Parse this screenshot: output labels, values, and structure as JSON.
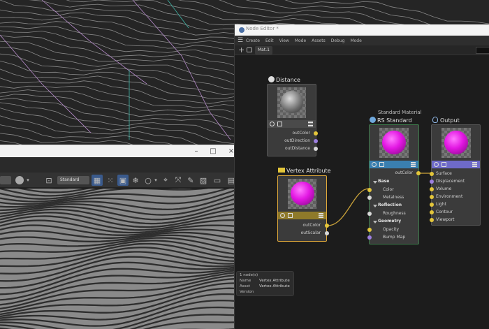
{
  "window": {
    "title": "Node Editor *",
    "menu": [
      "Create",
      "Edit",
      "View",
      "Mode",
      "Assets",
      "Debug",
      "Mode"
    ],
    "tab": "Mat.1"
  },
  "toolbar": {
    "dropdown_label": "Standard"
  },
  "nodes": {
    "distance": {
      "title": "Distance",
      "outputs": [
        "outColor",
        "outDirection",
        "outDistance"
      ]
    },
    "vertex_attribute": {
      "title": "Vertex Attribute",
      "outputs": [
        "outColor",
        "outScalar"
      ]
    },
    "rs_standard": {
      "subtitle": "Standard Material",
      "title": "RS Standard",
      "output": "outColor",
      "sections": {
        "base": "Base",
        "reflection": "Reflection",
        "geometry": "Geometry"
      },
      "ports": {
        "color": "Color",
        "metalness": "Metalness",
        "roughness": "Roughness",
        "opacity": "Opacity",
        "bump_map": "Bump Map"
      }
    },
    "output": {
      "title": "Output",
      "inputs": [
        "Surface",
        "Displacement",
        "Volume",
        "Environment",
        "Light",
        "Contour",
        "Viewport"
      ]
    }
  },
  "info_panel": {
    "count": "1 node(s)",
    "name_label": "Name",
    "name_value": "Vertex Attribute",
    "asset_label": "Asset",
    "asset_value": "Vertex Attribute",
    "version_label": "Version"
  },
  "colors": {
    "yellow_port": "#e3c53a",
    "purple_port": "#9c7fe0",
    "white_port": "#d8d8d8",
    "wire": "#c9a23a",
    "vertex_bar": "#8f7a2a",
    "distance_bar": "#4a4a4a",
    "rs_bar": "#3a7fb0",
    "output_bar": "#6e6ac9",
    "magenta": "#e216e2",
    "selection": "#e0a93a",
    "rs_border": "#3c7a4a"
  }
}
